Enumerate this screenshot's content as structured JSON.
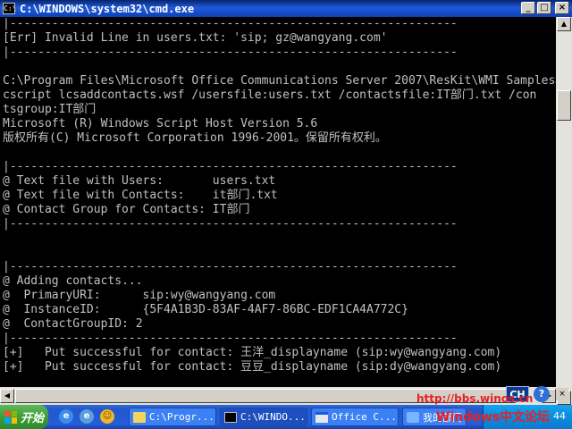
{
  "window": {
    "title": "C:\\WINDOWS\\system32\\cmd.exe",
    "minimize_glyph": "_",
    "maximize_glyph": "□",
    "close_glyph": "×"
  },
  "console_lines": [
    "|----------------------------------------------------------------",
    "[Err] Invalid Line in users.txt: 'sip; gz@wangyang.com'",
    "|----------------------------------------------------------------",
    "",
    "C:\\Program Files\\Microsoft Office Communications Server 2007\\ResKit\\WMI Samples>",
    "cscript lcsaddcontacts.wsf /usersfile:users.txt /contactsfile:IT部门.txt /con",
    "tsgroup:IT部门",
    "Microsoft (R) Windows Script Host Version 5.6",
    "版权所有(C) Microsoft Corporation 1996-2001。保留所有权利。",
    "",
    "|----------------------------------------------------------------",
    "@ Text file with Users:       users.txt",
    "@ Text file with Contacts:    it部门.txt",
    "@ Contact Group for Contacts: IT部门",
    "|----------------------------------------------------------------",
    "",
    "",
    "|----------------------------------------------------------------",
    "@ Adding contacts...",
    "@  PrimaryURI:      sip:wy@wangyang.com",
    "@  InstanceID:      {5F4A1B3D-83AF-4AF7-86BC-EDF1CA4A772C}",
    "@  ContactGroupID: 2",
    "|----------------------------------------------------------------",
    "[+]   Put successful for contact: 王洋_displayname (sip:wy@wangyang.com)",
    "[+]   Put successful for contact: 豆豆_displayname (sip:dy@wangyang.com)"
  ],
  "scrollbar": {
    "up_glyph": "▲",
    "down_glyph": "▼",
    "left_glyph": "◀",
    "right_glyph": "▶"
  },
  "overlay": {
    "language_indicator": "CH",
    "help_glyph": "?",
    "close_glyph": "×",
    "watermark_url": "http://bbs.winos.cn",
    "watermark_brand": "Windows中文论坛"
  },
  "taskbar": {
    "start_label": "开始",
    "quicklaunch": [
      {
        "name": "ie",
        "glyph": "e"
      },
      {
        "name": "ie-alt",
        "glyph": "e"
      },
      {
        "name": "msn",
        "glyph": "☺"
      }
    ],
    "tasks": [
      {
        "label": "C:\\Progr...",
        "icon": "folder",
        "active": false
      },
      {
        "label": "C:\\WINDO...",
        "icon": "cmd",
        "active": true
      },
      {
        "label": "Office C...",
        "icon": "window",
        "active": false
      },
      {
        "label": "我的部门",
        "icon": "app",
        "active": false
      }
    ],
    "clock": "44"
  },
  "colors": {
    "console_bg": "#000000",
    "console_text": "#c0c0c0",
    "titlebar": "#0a246a",
    "taskbar": "#245ed8",
    "start": "#3c9e38",
    "watermark": "#e82020"
  }
}
